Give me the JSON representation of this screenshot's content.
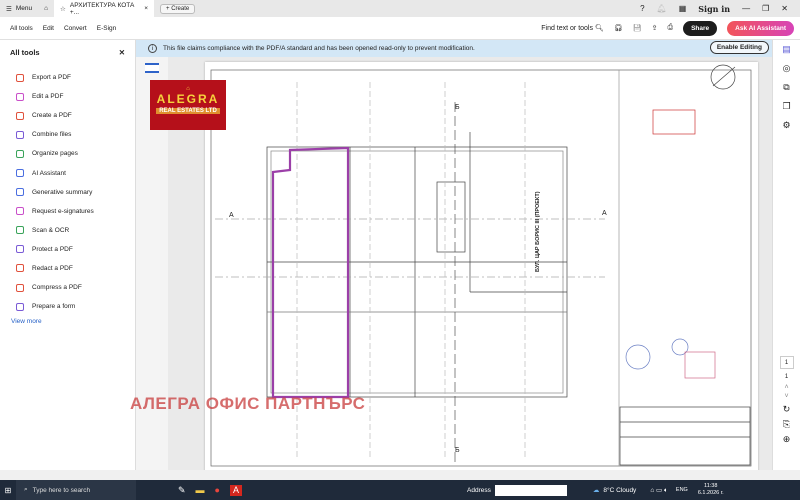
{
  "titlebar": {
    "menu": "Menu",
    "doc_tab": "АРХИТЕКТУРА КОТА +...",
    "create": "Create",
    "sign_in": "Sign in"
  },
  "menubar": {
    "items": [
      "All tools",
      "Edit",
      "Convert",
      "E-Sign"
    ],
    "find": "Find text or tools",
    "share": "Share",
    "ai": "Ask AI Assistant"
  },
  "banner": {
    "text": "This file claims compliance with the PDF/A standard and has been opened read-only to prevent modification.",
    "button": "Enable Editing"
  },
  "leftpanel": {
    "title": "All tools",
    "tools": [
      {
        "label": "Export a PDF",
        "color": "#e0513c"
      },
      {
        "label": "Edit a PDF",
        "color": "#c94fc9"
      },
      {
        "label": "Create a PDF",
        "color": "#e0513c"
      },
      {
        "label": "Combine files",
        "color": "#7a5bd6"
      },
      {
        "label": "Organize pages",
        "color": "#3aa35a"
      },
      {
        "label": "AI Assistant",
        "color": "#4a6ee0"
      },
      {
        "label": "Generative summary",
        "color": "#4a6ee0"
      },
      {
        "label": "Request e-signatures",
        "color": "#c94fc9"
      },
      {
        "label": "Scan & OCR",
        "color": "#3aa35a"
      },
      {
        "label": "Protect a PDF",
        "color": "#7a5bd6"
      },
      {
        "label": "Redact a PDF",
        "color": "#e0513c"
      },
      {
        "label": "Compress a PDF",
        "color": "#e0513c"
      },
      {
        "label": "Prepare a form",
        "color": "#7a5bd6"
      }
    ],
    "view_more": "View more"
  },
  "document": {
    "logo_top": "ALEGRA",
    "logo_bottom": "REAL ESTATES LTD",
    "watermark": "АЛЕГРА ОФИС ПАРТНЪРС",
    "side_label": "БУЛ. ЦАР БОРИС III (ПРОЕКТ)",
    "section_mark": "Б",
    "axis_mark": "А"
  },
  "rightrail": {
    "page_current": "1",
    "page_total": "1"
  },
  "taskbar": {
    "search": "Type here to search",
    "address_label": "Address",
    "weather": "8°C  Cloudy",
    "lang": "ENG",
    "time": "11:38",
    "date": "6.1.2026 г."
  }
}
